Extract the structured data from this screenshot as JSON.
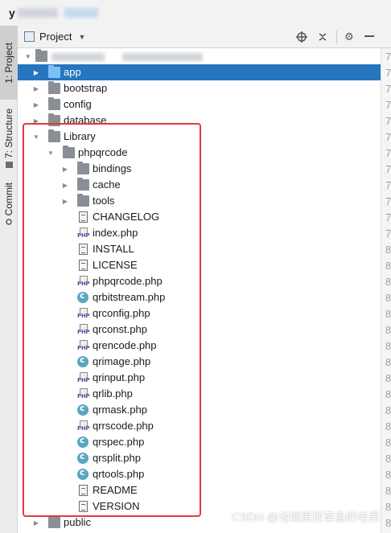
{
  "titlebar": {
    "project": "y"
  },
  "side_tabs": [
    "1: Project",
    "7: Structure",
    "Commit"
  ],
  "toolbar": {
    "view_label": "Project"
  },
  "tree": {
    "root_label": "",
    "items": [
      {
        "label": "app",
        "type": "folder",
        "depth": 1,
        "expanded": false,
        "selected": true
      },
      {
        "label": "bootstrap",
        "type": "folder",
        "depth": 1,
        "expanded": false
      },
      {
        "label": "config",
        "type": "folder",
        "depth": 1,
        "expanded": false
      },
      {
        "label": "database",
        "type": "folder",
        "depth": 1,
        "expanded": false
      },
      {
        "label": "Library",
        "type": "folder",
        "depth": 1,
        "expanded": true
      },
      {
        "label": "phpqrcode",
        "type": "folder",
        "depth": 2,
        "expanded": true
      },
      {
        "label": "bindings",
        "type": "folder",
        "depth": 3,
        "expanded": false
      },
      {
        "label": "cache",
        "type": "folder",
        "depth": 3,
        "expanded": false
      },
      {
        "label": "tools",
        "type": "folder",
        "depth": 3,
        "expanded": false
      },
      {
        "label": "CHANGELOG",
        "type": "text",
        "depth": 3
      },
      {
        "label": "index.php",
        "type": "php",
        "depth": 3
      },
      {
        "label": "INSTALL",
        "type": "text",
        "depth": 3
      },
      {
        "label": "LICENSE",
        "type": "text",
        "depth": 3
      },
      {
        "label": "phpqrcode.php",
        "type": "php",
        "depth": 3
      },
      {
        "label": "qrbitstream.php",
        "type": "class",
        "depth": 3
      },
      {
        "label": "qrconfig.php",
        "type": "php",
        "depth": 3
      },
      {
        "label": "qrconst.php",
        "type": "php",
        "depth": 3
      },
      {
        "label": "qrencode.php",
        "type": "php",
        "depth": 3
      },
      {
        "label": "qrimage.php",
        "type": "class",
        "depth": 3
      },
      {
        "label": "qrinput.php",
        "type": "php",
        "depth": 3
      },
      {
        "label": "qrlib.php",
        "type": "php",
        "depth": 3
      },
      {
        "label": "qrmask.php",
        "type": "class",
        "depth": 3
      },
      {
        "label": "qrrscode.php",
        "type": "php",
        "depth": 3
      },
      {
        "label": "qrspec.php",
        "type": "class",
        "depth": 3
      },
      {
        "label": "qrsplit.php",
        "type": "class",
        "depth": 3
      },
      {
        "label": "qrtools.php",
        "type": "class",
        "depth": 3
      },
      {
        "label": "README",
        "type": "text",
        "depth": 3
      },
      {
        "label": "VERSION",
        "type": "text",
        "depth": 3
      },
      {
        "label": "public",
        "type": "folder",
        "depth": 1,
        "expanded": false
      }
    ]
  },
  "gutter_numbers": [
    "7",
    "7",
    "7",
    "7",
    "7",
    "7",
    "7",
    "7",
    "7",
    "7",
    "7",
    "7",
    "8",
    "8",
    "8",
    "8",
    "8",
    "8",
    "8",
    "8",
    "8",
    "8",
    "8",
    "8",
    "8",
    "8",
    "8",
    "8",
    "8",
    "8"
  ],
  "php_tag": "PHP",
  "watermark": "CSDN @池塘里捉草鱼的老吴",
  "colors": {
    "selection": "#2675bf",
    "highlight_box": "#e53935",
    "folder": "#8a8f96",
    "folder_blue": "#3a8fde"
  }
}
